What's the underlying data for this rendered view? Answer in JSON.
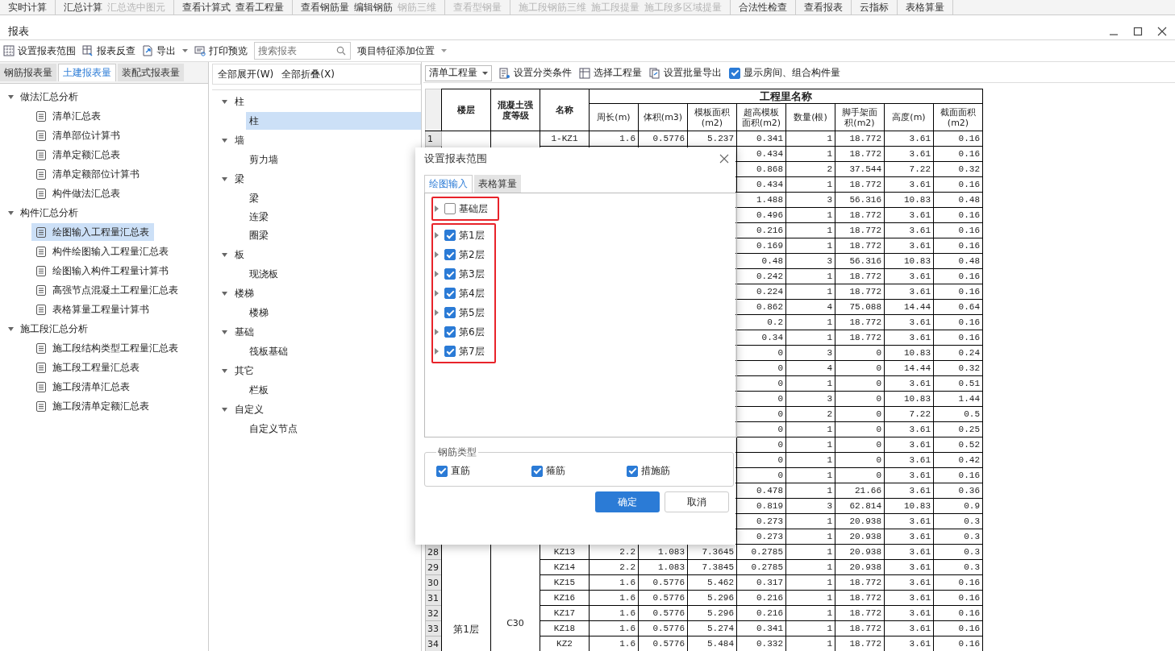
{
  "ribbon": [
    [
      {
        "label": "实时计算",
        "disabled": false
      }
    ],
    [
      {
        "label": "汇总计算",
        "disabled": false
      },
      {
        "label": "汇总选中图元",
        "disabled": true
      }
    ],
    [
      {
        "label": "查看计算式",
        "disabled": false
      },
      {
        "label": "查看工程量",
        "disabled": false
      }
    ],
    [
      {
        "label": "查看钢筋量",
        "disabled": false
      },
      {
        "label": "编辑钢筋",
        "disabled": false
      },
      {
        "label": "钢筋三维",
        "disabled": true
      }
    ],
    [
      {
        "label": "查看型钢量",
        "disabled": true
      }
    ],
    [
      {
        "label": "施工段钢筋三维",
        "disabled": true
      },
      {
        "label": "施工段提量",
        "disabled": true
      },
      {
        "label": "施工段多区域提量",
        "disabled": true
      }
    ],
    [
      {
        "label": "合法性检查",
        "disabled": false
      }
    ],
    [
      {
        "label": "查看报表",
        "disabled": false
      }
    ],
    [
      {
        "label": "云指标",
        "disabled": false
      }
    ],
    [
      {
        "label": "表格算量",
        "disabled": false
      }
    ]
  ],
  "window": {
    "title": "报表"
  },
  "toolbar": {
    "set_range": "设置报表范围",
    "reverse_lookup": "报表反查",
    "export": "导出",
    "print_preview": "打印预览",
    "search_placeholder": "搜索报表",
    "feature_position": "项目特征添加位置"
  },
  "report_tabs": [
    {
      "label": "钢筋报表量",
      "selected": false
    },
    {
      "label": "土建报表量",
      "selected": true
    },
    {
      "label": "装配式报表量",
      "selected": false
    }
  ],
  "report_tree": [
    {
      "label": "做法汇总分析",
      "expanded": true,
      "children": [
        {
          "label": "清单汇总表",
          "selected": false
        },
        {
          "label": "清单部位计算书",
          "selected": false
        },
        {
          "label": "清单定额汇总表",
          "selected": false
        },
        {
          "label": "清单定额部位计算书",
          "selected": false
        },
        {
          "label": "构件做法汇总表",
          "selected": false
        }
      ]
    },
    {
      "label": "构件汇总分析",
      "expanded": true,
      "children": [
        {
          "label": "绘图输入工程量汇总表",
          "selected": true
        },
        {
          "label": "构件绘图输入工程量汇总表",
          "selected": false
        },
        {
          "label": "绘图输入构件工程量计算书",
          "selected": false
        },
        {
          "label": "高强节点混凝土工程量汇总表",
          "selected": false
        },
        {
          "label": "表格算量工程量计算书",
          "selected": false
        }
      ]
    },
    {
      "label": "施工段汇总分析",
      "expanded": true,
      "children": [
        {
          "label": "施工段结构类型工程量汇总表",
          "selected": false
        },
        {
          "label": "施工段工程量汇总表",
          "selected": false
        },
        {
          "label": "施工段清单汇总表",
          "selected": false
        },
        {
          "label": "施工段清单定额汇总表",
          "selected": false
        }
      ]
    }
  ],
  "component_toolbar": {
    "expand_all": "全部展开(W)",
    "collapse_all": "全部折叠(X)"
  },
  "component_tree": [
    {
      "label": "柱",
      "expanded": true,
      "children": [
        {
          "label": "柱",
          "selected": true
        }
      ]
    },
    {
      "label": "墙",
      "expanded": true,
      "children": [
        {
          "label": "剪力墙",
          "selected": false
        }
      ]
    },
    {
      "label": "梁",
      "expanded": true,
      "children": [
        {
          "label": "梁",
          "selected": false
        },
        {
          "label": "连梁",
          "selected": false
        },
        {
          "label": "圈梁",
          "selected": false
        }
      ]
    },
    {
      "label": "板",
      "expanded": true,
      "children": [
        {
          "label": "现浇板",
          "selected": false
        }
      ]
    },
    {
      "label": "楼梯",
      "expanded": true,
      "children": [
        {
          "label": "楼梯",
          "selected": false
        }
      ]
    },
    {
      "label": "基础",
      "expanded": true,
      "children": [
        {
          "label": "筏板基础",
          "selected": false
        }
      ]
    },
    {
      "label": "其它",
      "expanded": true,
      "children": [
        {
          "label": "栏板",
          "selected": false
        }
      ]
    },
    {
      "label": "自定义",
      "expanded": true,
      "children": [
        {
          "label": "自定义节点",
          "selected": false
        }
      ]
    }
  ],
  "table_toolbar": {
    "quantity_type": "清单工程量",
    "set_classification": "设置分类条件",
    "select_quantity": "选择工程量",
    "batch_export": "设置批量导出",
    "show_rooms": {
      "label": "显示房间、组合构件量",
      "checked": true
    }
  },
  "table": {
    "group_header": "工程里名称",
    "columns": [
      "楼层",
      "混凝土强度等级",
      "名称",
      "周长(m)",
      "体积(m3)",
      "模板面积(m2)",
      "超高模板面积(m2)",
      "数量(根)",
      "脚手架面积(m2)",
      "高度(m)",
      "截面面积(m2)"
    ],
    "floor": "第1层",
    "grade": "C30",
    "rows": [
      {
        "number": "1",
        "cells": [
          "",
          "",
          "1-KZ1",
          "1.6",
          "0.5776",
          "5.237",
          "0.341",
          "1",
          "18.772",
          "3.61",
          "0.16"
        ]
      },
      {
        "cells": [
          "",
          "",
          "",
          "",
          "",
          "",
          "0.434",
          "1",
          "18.772",
          "3.61",
          "0.16"
        ]
      },
      {
        "cells": [
          "",
          "",
          "",
          "",
          "",
          "",
          "0.868",
          "2",
          "37.544",
          "7.22",
          "0.32"
        ]
      },
      {
        "cells": [
          "",
          "",
          "",
          "",
          "",
          "",
          "0.434",
          "1",
          "18.772",
          "3.61",
          "0.16"
        ]
      },
      {
        "cells": [
          "",
          "",
          "",
          "",
          "",
          "",
          "1.488",
          "3",
          "56.316",
          "10.83",
          "0.48"
        ]
      },
      {
        "cells": [
          "",
          "",
          "",
          "",
          "",
          "",
          "0.496",
          "1",
          "18.772",
          "3.61",
          "0.16"
        ]
      },
      {
        "cells": [
          "",
          "",
          "",
          "",
          "",
          "",
          "0.216",
          "1",
          "18.772",
          "3.61",
          "0.16"
        ]
      },
      {
        "cells": [
          "",
          "",
          "",
          "",
          "",
          "",
          "0.169",
          "1",
          "18.772",
          "3.61",
          "0.16"
        ]
      },
      {
        "cells": [
          "",
          "",
          "",
          "",
          "",
          "",
          "0.48",
          "3",
          "56.316",
          "10.83",
          "0.48"
        ]
      },
      {
        "cells": [
          "",
          "",
          "",
          "",
          "",
          "",
          "0.242",
          "1",
          "18.772",
          "3.61",
          "0.16"
        ]
      },
      {
        "cells": [
          "",
          "",
          "",
          "",
          "",
          "",
          "0.224",
          "1",
          "18.772",
          "3.61",
          "0.16"
        ]
      },
      {
        "cells": [
          "",
          "",
          "",
          "",
          "",
          "",
          "0.862",
          "4",
          "75.088",
          "14.44",
          "0.64"
        ]
      },
      {
        "cells": [
          "",
          "",
          "",
          "",
          "",
          "",
          "0.2",
          "1",
          "18.772",
          "3.61",
          "0.16"
        ]
      },
      {
        "cells": [
          "",
          "",
          "",
          "",
          "",
          "",
          "0.34",
          "1",
          "18.772",
          "3.61",
          "0.16"
        ]
      },
      {
        "cells": [
          "",
          "",
          "",
          "",
          "",
          "",
          "0",
          "3",
          "0",
          "10.83",
          "0.24"
        ]
      },
      {
        "cells": [
          "",
          "",
          "",
          "",
          "",
          "",
          "0",
          "4",
          "0",
          "14.44",
          "0.32"
        ]
      },
      {
        "cells": [
          "",
          "",
          "",
          "",
          "",
          "",
          "0",
          "1",
          "0",
          "3.61",
          "0.51"
        ]
      },
      {
        "cells": [
          "",
          "",
          "",
          "",
          "",
          "",
          "0",
          "3",
          "0",
          "10.83",
          "1.44"
        ]
      },
      {
        "cells": [
          "",
          "",
          "",
          "",
          "",
          "",
          "0",
          "2",
          "0",
          "7.22",
          "0.5"
        ]
      },
      {
        "cells": [
          "",
          "",
          "",
          "",
          "",
          "",
          "0",
          "1",
          "0",
          "3.61",
          "0.25"
        ]
      },
      {
        "cells": [
          "",
          "",
          "",
          "",
          "",
          "",
          "0",
          "1",
          "0",
          "3.61",
          "0.52"
        ]
      },
      {
        "cells": [
          "",
          "",
          "",
          "",
          "",
          "",
          "0",
          "1",
          "0",
          "3.61",
          "0.42"
        ]
      },
      {
        "cells": [
          "",
          "",
          "",
          "",
          "",
          "",
          "0",
          "1",
          "0",
          "3.61",
          "0.16"
        ]
      },
      {
        "cells": [
          "",
          "",
          "",
          "",
          "",
          "",
          "0.478",
          "1",
          "21.66",
          "3.61",
          "0.36"
        ]
      },
      {
        "cells": [
          "",
          "",
          "",
          "",
          "",
          "",
          "0.819",
          "3",
          "62.814",
          "10.83",
          "0.9"
        ]
      },
      {
        "cells": [
          "",
          "",
          "",
          "",
          "",
          "",
          "0.273",
          "1",
          "20.938",
          "3.61",
          "0.3"
        ]
      },
      {
        "cells": [
          "",
          "",
          "",
          "",
          "",
          "",
          "0.273",
          "1",
          "20.938",
          "3.61",
          "0.3"
        ]
      },
      {
        "number": "28",
        "cells": [
          "",
          "",
          "KZ13",
          "2.2",
          "1.083",
          "7.3645",
          "0.2785",
          "1",
          "20.938",
          "3.61",
          "0.3"
        ]
      },
      {
        "number": "29",
        "cells": [
          "",
          "",
          "KZ14",
          "2.2",
          "1.083",
          "7.3845",
          "0.2785",
          "1",
          "20.938",
          "3.61",
          "0.3"
        ]
      },
      {
        "number": "30",
        "cells": [
          "",
          "",
          "KZ15",
          "1.6",
          "0.5776",
          "5.462",
          "0.317",
          "1",
          "18.772",
          "3.61",
          "0.16"
        ]
      },
      {
        "number": "31",
        "cells": [
          "",
          "",
          "KZ16",
          "1.6",
          "0.5776",
          "5.296",
          "0.216",
          "1",
          "18.772",
          "3.61",
          "0.16"
        ]
      },
      {
        "number": "32",
        "cells": [
          "",
          "",
          "KZ17",
          "1.6",
          "0.5776",
          "5.296",
          "0.216",
          "1",
          "18.772",
          "3.61",
          "0.16"
        ]
      },
      {
        "number": "33",
        "cells": [
          "",
          "",
          "KZ18",
          "1.6",
          "0.5776",
          "5.274",
          "0.341",
          "1",
          "18.772",
          "3.61",
          "0.16"
        ]
      },
      {
        "number": "34",
        "cells": [
          "",
          "",
          "KZ2",
          "1.6",
          "0.5776",
          "5.484",
          "0.332",
          "1",
          "18.772",
          "3.61",
          "0.16"
        ]
      }
    ]
  },
  "dialog": {
    "title": "设置报表范围",
    "tabs": [
      {
        "label": "绘图输入",
        "selected": true
      },
      {
        "label": "表格算量",
        "selected": false
      }
    ],
    "floor_groups": [
      {
        "floors": [
          {
            "label": "基础层",
            "checked": false
          }
        ]
      },
      {
        "floors": [
          {
            "label": "第1层",
            "checked": true
          },
          {
            "label": "第2层",
            "checked": true
          },
          {
            "label": "第3层",
            "checked": true
          },
          {
            "label": "第4层",
            "checked": true
          },
          {
            "label": "第5层",
            "checked": true
          },
          {
            "label": "第6层",
            "checked": true
          },
          {
            "label": "第7层",
            "checked": true
          }
        ]
      }
    ],
    "rebar_legend": "钢筋类型",
    "rebar_types": [
      {
        "label": "直筋",
        "checked": true
      },
      {
        "label": "箍筋",
        "checked": true
      },
      {
        "label": "措施筋",
        "checked": true
      }
    ],
    "buttons": [
      {
        "label": "确定",
        "kind": "primary"
      },
      {
        "label": "取消",
        "kind": "secondary"
      }
    ]
  }
}
